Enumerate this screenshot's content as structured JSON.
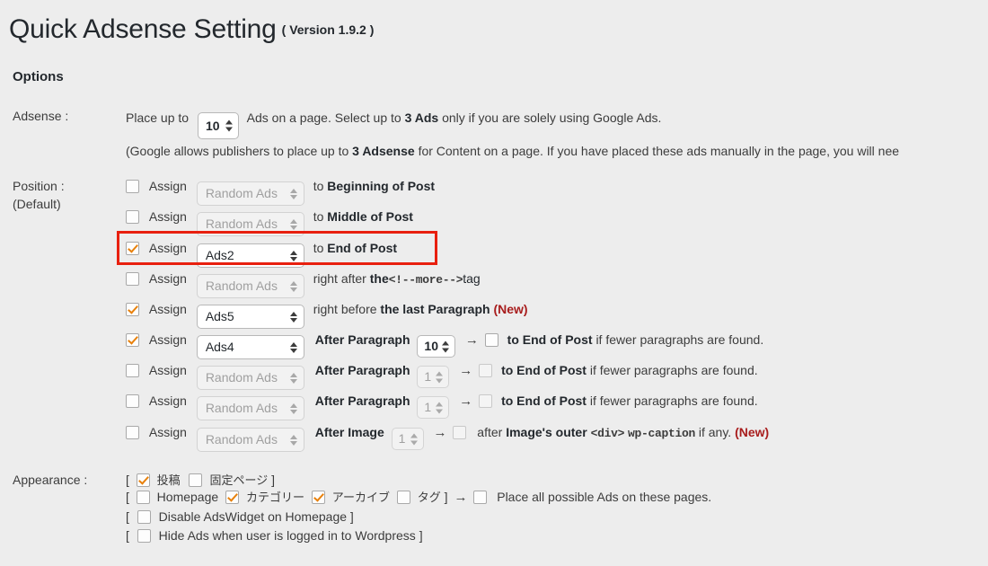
{
  "header": {
    "title": "Quick Adsense Setting",
    "version": "( Version 1.9.2 )",
    "options_heading": "Options"
  },
  "adsense": {
    "label": "Adsense :",
    "place_up_to": "Place up to",
    "count_value": "10",
    "ads_on_page": "Ads on a page. Select up to",
    "three_ads": "3 Ads",
    "only_if": "only if you are solely using Google Ads.",
    "note_before": "(Google allows publishers to place up to",
    "note_bold": "3 Adsense",
    "note_after": "for Content on a page. If you have placed these ads manually in the page, you will nee"
  },
  "position": {
    "label": "Position :",
    "sublabel": "(Default)",
    "assign_label": "Assign",
    "default_option": "Random Ads",
    "after_paragraph_label": "After Paragraph",
    "after_image_label": "After Image",
    "arrow": "→",
    "to_end_suffix": "to End of Post if fewer paragraphs are found.",
    "rows": [
      {
        "checked": false,
        "select": "Random Ads",
        "select_disabled": true,
        "to": "to",
        "target": "Beginning of Post"
      },
      {
        "checked": false,
        "select": "Random Ads",
        "select_disabled": true,
        "to": "to",
        "target": "Middle of Post"
      },
      {
        "checked": true,
        "select": "Ads2",
        "select_disabled": false,
        "to": "to",
        "target": "End of Post",
        "highlighted": true
      },
      {
        "checked": false,
        "select": "Random Ads",
        "select_disabled": true,
        "to": "right after",
        "target": "the",
        "code": "<!--more-->",
        "target_tail": "tag"
      },
      {
        "checked": true,
        "select": "Ads5",
        "select_disabled": false,
        "to": "right before",
        "target": "the last Paragraph",
        "badge": "(New)"
      }
    ],
    "paragraph_rows": [
      {
        "checked": true,
        "select": "Ads4",
        "select_disabled": false,
        "paragraph_number": "10",
        "number_disabled": false,
        "sub_checked": false,
        "sub_disabled": false
      },
      {
        "checked": false,
        "select": "Random Ads",
        "select_disabled": true,
        "paragraph_number": "1",
        "number_disabled": true,
        "sub_checked": false,
        "sub_disabled": true
      },
      {
        "checked": false,
        "select": "Random Ads",
        "select_disabled": true,
        "paragraph_number": "1",
        "number_disabled": true,
        "sub_checked": false,
        "sub_disabled": true
      }
    ],
    "image_row": {
      "checked": false,
      "select": "Random Ads",
      "number": "1",
      "after_text": "after",
      "bold_text": "Image's outer",
      "code1": "<div>",
      "code2": "wp-caption",
      "tail": "if any.",
      "badge": "(New)"
    }
  },
  "appearance": {
    "label": "Appearance :",
    "bracket_open": "[",
    "bracket_close": "]",
    "row1": {
      "post_checked": true,
      "post_label": "投稿",
      "page_checked": false,
      "page_label": "固定ページ"
    },
    "row2": {
      "homepage_checked": false,
      "homepage_label": "Homepage",
      "category_checked": true,
      "category_label": "カテゴリー",
      "archive_checked": true,
      "archive_label": "アーカイブ",
      "tag_checked": false,
      "tag_label": "タグ",
      "arrow": "→",
      "final_checked": false,
      "final_label": "Place all possible Ads on these pages."
    },
    "row3": {
      "checked": false,
      "label": "Disable AdsWidget on Homepage"
    },
    "row4": {
      "checked": false,
      "label": "Hide Ads when user is logged in to Wordpress"
    }
  },
  "colors": {
    "background": "#ededed",
    "highlight_red": "#e8200f",
    "check_orange": "#e8800a",
    "new_badge_red": "#a81d1d"
  }
}
